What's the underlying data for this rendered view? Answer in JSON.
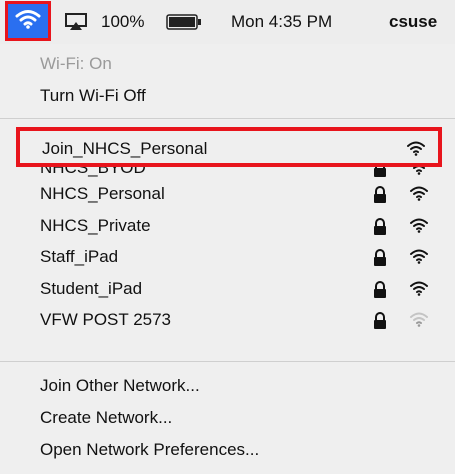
{
  "menubar": {
    "battery_percent": "100%",
    "clock": "Mon 4:35 PM",
    "user": "csuse"
  },
  "wifi_menu": {
    "status": "Wi-Fi: On",
    "toggle_label": "Turn Wi-Fi Off",
    "joined_network": {
      "name": "Join_NHCS_Personal",
      "signal": "full"
    },
    "networks": [
      {
        "name": "NHCS_BYOD",
        "locked": true,
        "signal": "full"
      },
      {
        "name": "NHCS_Personal",
        "locked": true,
        "signal": "full"
      },
      {
        "name": "NHCS_Private",
        "locked": true,
        "signal": "full"
      },
      {
        "name": "Staff_iPad",
        "locked": true,
        "signal": "full"
      },
      {
        "name": "Student_iPad",
        "locked": true,
        "signal": "full"
      },
      {
        "name": "VFW POST 2573",
        "locked": true,
        "signal": "weak"
      }
    ],
    "actions": [
      "Join Other Network...",
      "Create Network...",
      "Open Network Preferences..."
    ]
  },
  "colors": {
    "highlight": "#2a6ff0",
    "annotation_red": "#e8141c"
  }
}
